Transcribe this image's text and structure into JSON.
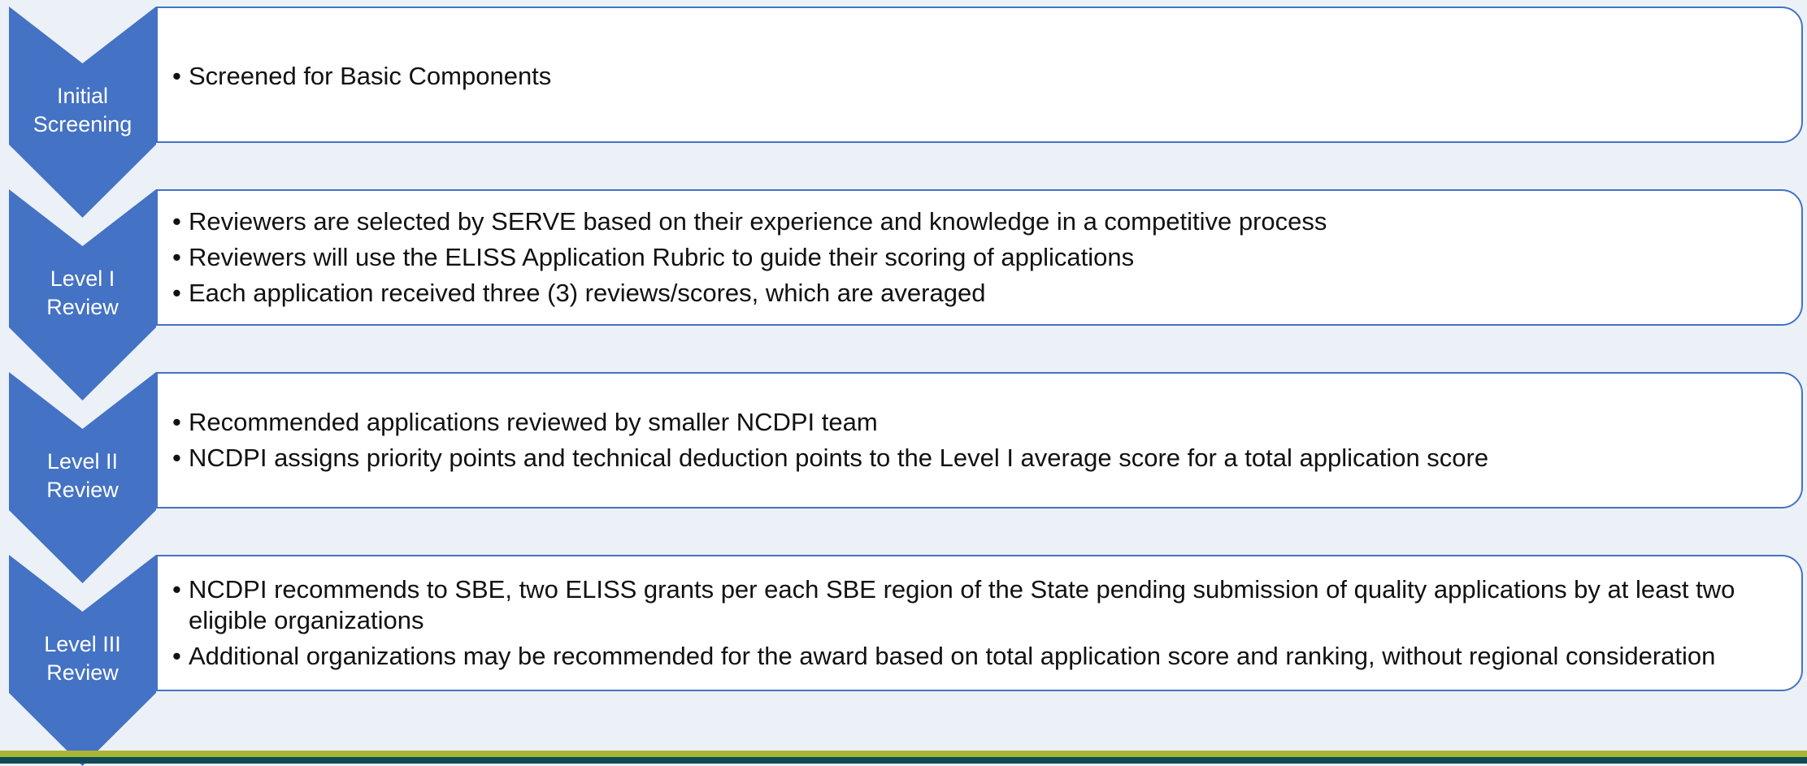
{
  "stages": [
    {
      "label_line1": "Initial",
      "label_line2": "Screening",
      "bullets": [
        "Screened for Basic Components"
      ]
    },
    {
      "label_line1": "Level I",
      "label_line2": "Review",
      "bullets": [
        "Reviewers are selected by SERVE based on their experience and knowledge in a competitive process",
        "Reviewers will use the ELISS Application Rubric to guide their scoring of applications",
        "Each application received three (3) reviews/scores, which are averaged"
      ]
    },
    {
      "label_line1": "Level II",
      "label_line2": "Review",
      "bullets": [
        "Recommended applications reviewed by smaller NCDPI team",
        "NCDPI assigns priority points and technical deduction points to the Level I average score for a total application score"
      ]
    },
    {
      "label_line1": "Level III",
      "label_line2": "Review",
      "bullets": [
        "NCDPI recommends to SBE, two ELISS grants per each SBE region of the State pending submission of quality applications by at least two eligible organizations",
        "Additional organizations may be recommended for the award based on total application score and ranking, without regional consideration"
      ]
    }
  ],
  "colors": {
    "chevron": "#4472c4",
    "box_border": "#4472c4",
    "background": "#ecf1f8",
    "footer_stripe": "#aab534",
    "footer_bar": "#0e4a57"
  }
}
